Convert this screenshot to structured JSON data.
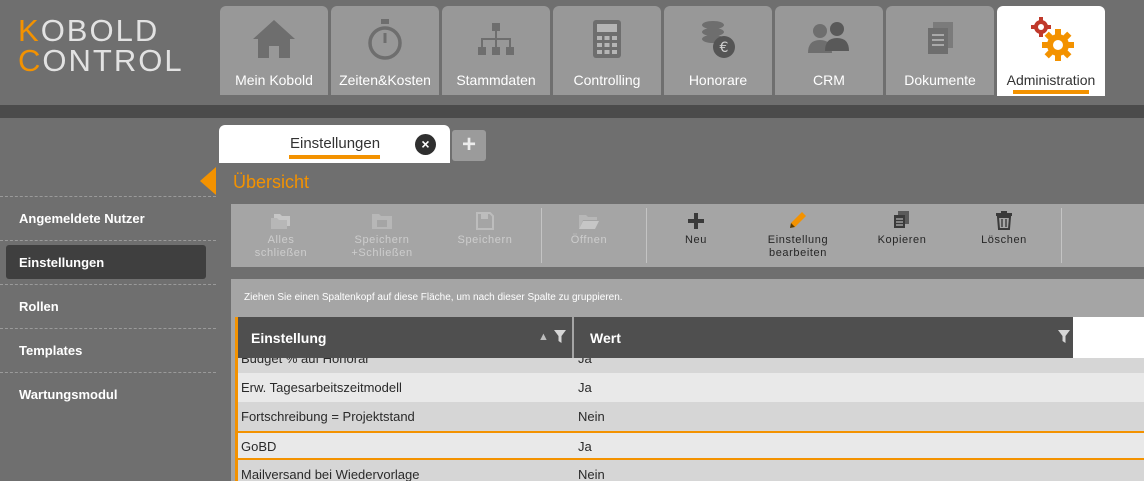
{
  "logo": {
    "line1_accent": "K",
    "line1_rest": "OBOLD",
    "line2_accent": "C",
    "line2_rest": "ONTROL"
  },
  "main_tabs": [
    {
      "label": "Mein Kobold",
      "icon": "home-icon"
    },
    {
      "label": "Zeiten&Kosten",
      "icon": "stopwatch-icon"
    },
    {
      "label": "Stammdaten",
      "icon": "hierarchy-icon"
    },
    {
      "label": "Controlling",
      "icon": "calculator-icon"
    },
    {
      "label": "Honorare",
      "icon": "euro-coins-icon"
    },
    {
      "label": "CRM",
      "icon": "people-icon"
    },
    {
      "label": "Dokumente",
      "icon": "documents-icon"
    },
    {
      "label": "Administration",
      "icon": "gears-icon",
      "active": true
    }
  ],
  "sidebar": {
    "items": [
      {
        "label": "Angemeldete Nutzer"
      },
      {
        "label": "Einstellungen",
        "active": true
      },
      {
        "label": "Rollen"
      },
      {
        "label": "Templates"
      },
      {
        "label": "Wartungsmodul"
      }
    ]
  },
  "subtabs": {
    "active_label": "Einstellungen",
    "close_glyph": "×",
    "add_glyph": "+"
  },
  "section_title": "Übersicht",
  "toolbar": {
    "buttons": [
      {
        "label1": "Alles",
        "label2": "schließen",
        "enabled": false,
        "icon": "folders-icon"
      },
      {
        "label1": "Speichern",
        "label2": "+Schließen",
        "enabled": false,
        "icon": "folder-save-icon"
      },
      {
        "label1": "Speichern",
        "label2": "",
        "enabled": false,
        "icon": "floppy-icon"
      },
      {
        "label1": "Öffnen",
        "label2": "",
        "enabled": false,
        "icon": "folder-open-icon"
      },
      {
        "label1": "Neu",
        "label2": "",
        "enabled": true,
        "icon": "plus-icon"
      },
      {
        "label1": "Einstellung",
        "label2": "bearbeiten",
        "enabled": true,
        "icon": "pencil-icon"
      },
      {
        "label1": "Kopieren",
        "label2": "",
        "enabled": true,
        "icon": "copy-icon"
      },
      {
        "label1": "Löschen",
        "label2": "",
        "enabled": true,
        "icon": "trash-icon"
      }
    ]
  },
  "grid": {
    "group_hint": "Ziehen Sie einen Spaltenkopf auf diese Fläche, um nach dieser Spalte zu gruppieren.",
    "columns": [
      "Einstellung",
      "Wert"
    ],
    "rows": [
      {
        "setting": "Budget % auf Honorar",
        "value": "Ja"
      },
      {
        "setting": "Erw. Tagesarbeitszeitmodell",
        "value": "Ja"
      },
      {
        "setting": "Fortschreibung = Projektstand",
        "value": "Nein"
      },
      {
        "setting": "GoBD",
        "value": "Ja",
        "selected": true
      },
      {
        "setting": "Mailversand bei Wiedervorlage",
        "value": "Nein"
      }
    ]
  },
  "colors": {
    "accent": "#f39200",
    "background": "#6f6f6f",
    "tab_inactive": "#989898",
    "panel": "#a5a5a5",
    "header_dark": "#4f4f4f"
  }
}
